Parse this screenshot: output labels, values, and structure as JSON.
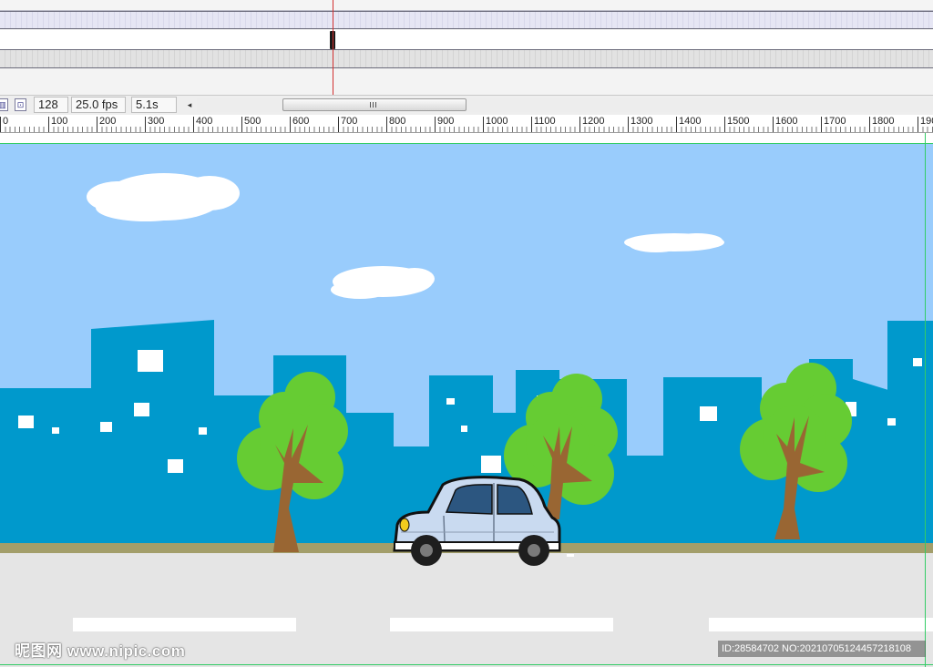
{
  "timeline": {
    "playhead_color": "#d23030"
  },
  "status_bar": {
    "icons": [
      "onion-skin-icon",
      "center-frame-icon"
    ],
    "frame": "128",
    "fps": "25.0 fps",
    "time": "5.1s",
    "scroll_left_arrow": "◂"
  },
  "ruler": {
    "labels": [
      "0",
      "100",
      "200",
      "300",
      "400",
      "500",
      "600",
      "700",
      "800",
      "900",
      "1000",
      "1100",
      "1200",
      "1300",
      "1400",
      "1500",
      "1600",
      "1700",
      "1800",
      "190"
    ]
  },
  "scene": {
    "sky_color": "#99ccfc",
    "building_color": "#0099cc",
    "tree_color": "#66cc33",
    "trunk_color": "#996633",
    "road_color": "#e5e5e5",
    "curb_color": "#a39e6a",
    "car_color": "#c9daf0"
  },
  "watermarks": {
    "left": "昵图网 www.nipic.com",
    "right": "ID:28584702 NO:20210705124457218108"
  }
}
